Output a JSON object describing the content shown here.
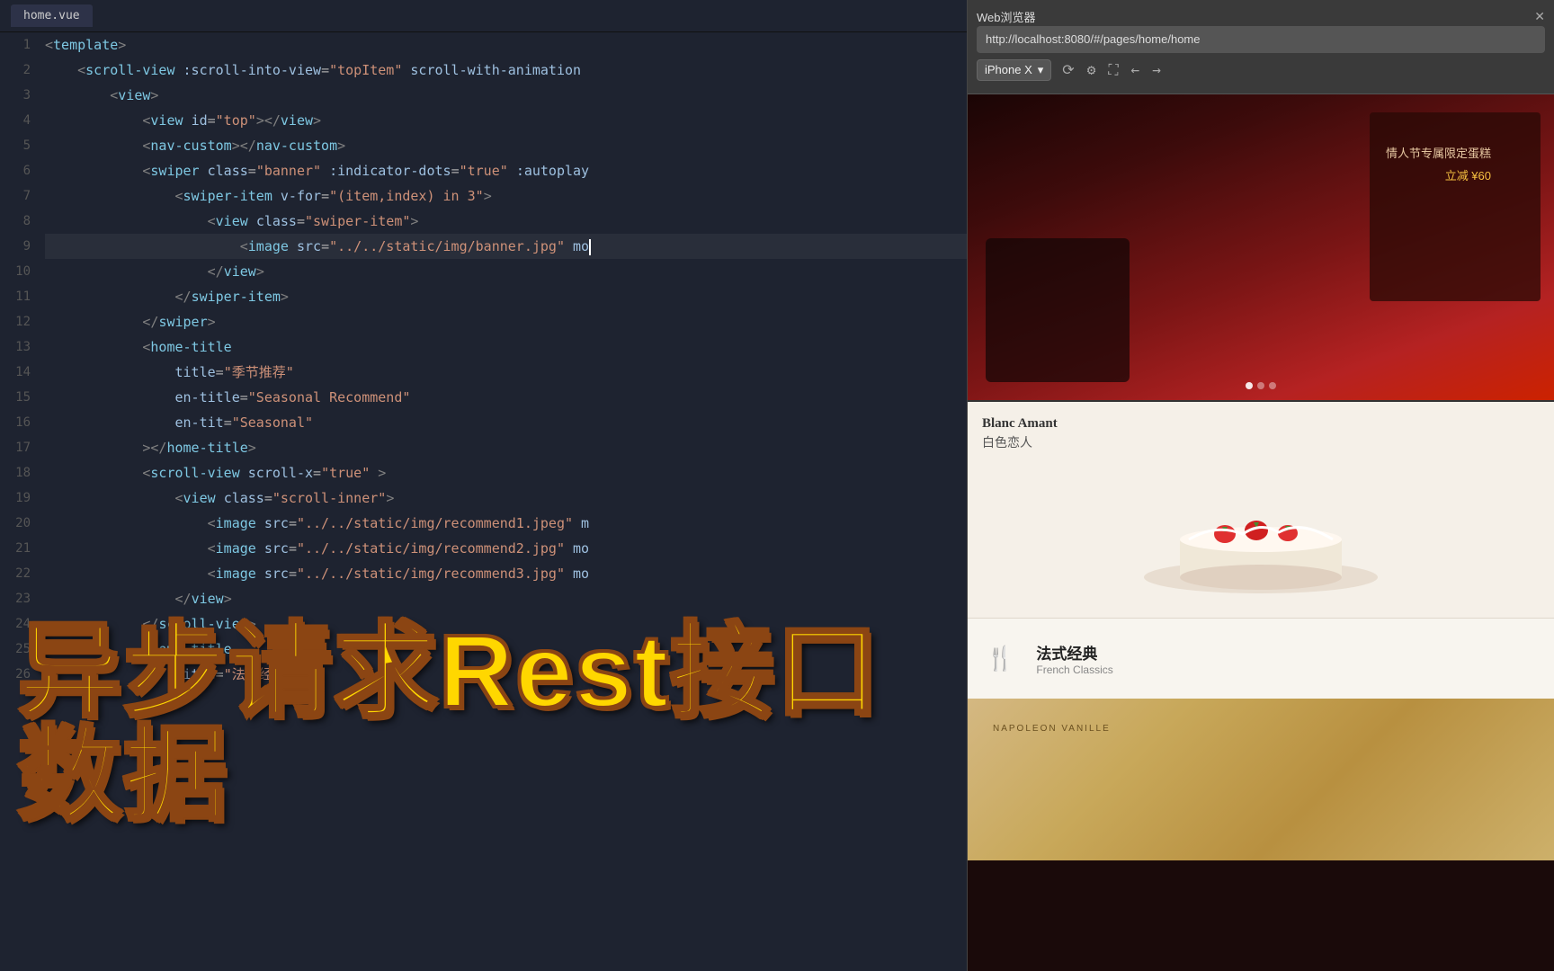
{
  "tab": {
    "label": "home.vue"
  },
  "browser": {
    "title": "Web浏览器",
    "close_label": "✕",
    "url": "http://localhost:8080/#/pages/home/home",
    "device": "iPhone X",
    "device_dropdown_arrow": "▾"
  },
  "overlay": {
    "main_title": "异步请求Rest接口数据"
  },
  "code_lines": [
    {
      "num": "1",
      "content": "<template>"
    },
    {
      "num": "2",
      "content": "    <scroll-view :scroll-into-view=\"topItem\" scroll-with-animation"
    },
    {
      "num": "3",
      "content": "        <view>"
    },
    {
      "num": "4",
      "content": "            <view id=\"top\"></view>"
    },
    {
      "num": "5",
      "content": "            <nav-custom></nav-custom>"
    },
    {
      "num": "6",
      "content": "            <swiper class=\"banner\" :indicator-dots=\"true\" :autoplay"
    },
    {
      "num": "7",
      "content": "                <swiper-item v-for=\"(item,index) in 3\">"
    },
    {
      "num": "8",
      "content": "                    <view class=\"swiper-item\">"
    },
    {
      "num": "9",
      "content": "                        <image src=\"../../static/img/banner.jpg\" mo"
    },
    {
      "num": "10",
      "content": "                    </view>"
    },
    {
      "num": "11",
      "content": "                </swiper-item>"
    },
    {
      "num": "12",
      "content": "            </swiper>"
    },
    {
      "num": "13",
      "content": "            <home-title"
    },
    {
      "num": "14",
      "content": "                title=\"季节推荐\""
    },
    {
      "num": "15",
      "content": "                en-title=\"Seasonal Recommend\""
    },
    {
      "num": "16",
      "content": "                en-tit=\"Seasonal\""
    },
    {
      "num": "17",
      "content": "            ></home-title>"
    },
    {
      "num": "18",
      "content": "            <scroll-view scroll-x=\"true\" >"
    },
    {
      "num": "19",
      "content": "                <view class=\"scroll-inner\">"
    },
    {
      "num": "20",
      "content": "                    <image src=\"../../static/img/recommend1.jpeg\" m"
    },
    {
      "num": "21",
      "content": "                    <image src=\"../../static/img/recommend2.jpg\" mo"
    },
    {
      "num": "22",
      "content": "                    <image src=\"../../static/img/recommend3.jpg\" mo"
    },
    {
      "num": "23",
      "content": "                </view>"
    },
    {
      "num": "24",
      "content": "            </scroll-view>"
    },
    {
      "num": "25",
      "content": "            <home-title"
    },
    {
      "num": "26",
      "content": "                title=\"法式经典\""
    }
  ],
  "preview": {
    "banner_text_line1": "情人节专属限定蛋糕",
    "banner_text_line2": "立减 ¥60",
    "cake_brand": "Blanc Amant",
    "cake_name_cn": "白色恋人",
    "french_icon": "🍴",
    "french_title_cn": "法式经典",
    "french_title_en": "French Classics",
    "napoleon_label": "NAPOLEON VANILLE"
  }
}
